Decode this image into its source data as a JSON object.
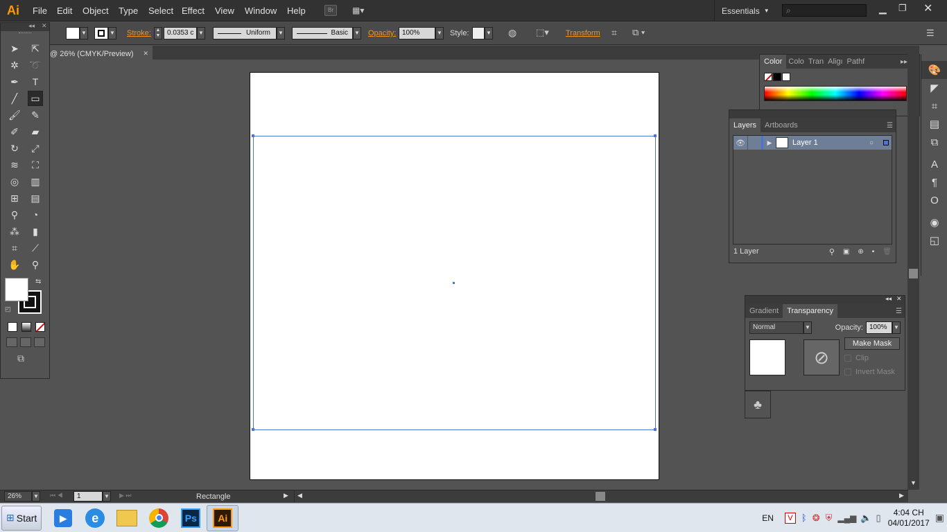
{
  "app": {
    "logo": "Ai",
    "workspace": "Essentials"
  },
  "menu": [
    "File",
    "Edit",
    "Object",
    "Type",
    "Select",
    "Effect",
    "View",
    "Window",
    "Help"
  ],
  "menubar_buttons": {
    "bridge": "Br"
  },
  "control": {
    "stroke_label": "Stroke:",
    "stroke_value": "0.0353 c",
    "profile": "Uniform",
    "brush": "Basic",
    "opacity_label": "Opacity:",
    "opacity_value": "100%",
    "style_label": "Style:",
    "transform_label": "Transform"
  },
  "document": {
    "tab_title": "@ 26% (CMYK/Preview)",
    "close": "✕"
  },
  "color_panel": {
    "tabs": [
      "Color",
      "Colo",
      "Tran",
      "Aligı",
      "Pathf"
    ]
  },
  "layers_panel": {
    "tabs": [
      "Layers",
      "Artboards"
    ],
    "layer_name": "Layer 1",
    "footer": "1 Layer"
  },
  "transparency_panel": {
    "tabs": [
      "Gradient",
      "Transparency"
    ],
    "blend_mode": "Normal",
    "opacity_label": "Opacity:",
    "opacity_value": "100%",
    "make_mask": "Make Mask",
    "clip": "Clip",
    "invert_mask": "Invert Mask"
  },
  "status": {
    "zoom": "26%",
    "artboard_num": "1",
    "tool_name": "Rectangle"
  },
  "taskbar": {
    "start": "Start",
    "lang": "EN",
    "time": "4:04 CH",
    "date": "04/01/2017",
    "ps_label": "Ps",
    "ai_label": "Ai"
  },
  "colors": {
    "accent_orange": "#f7941d",
    "selection_blue": "#4a74d6"
  }
}
